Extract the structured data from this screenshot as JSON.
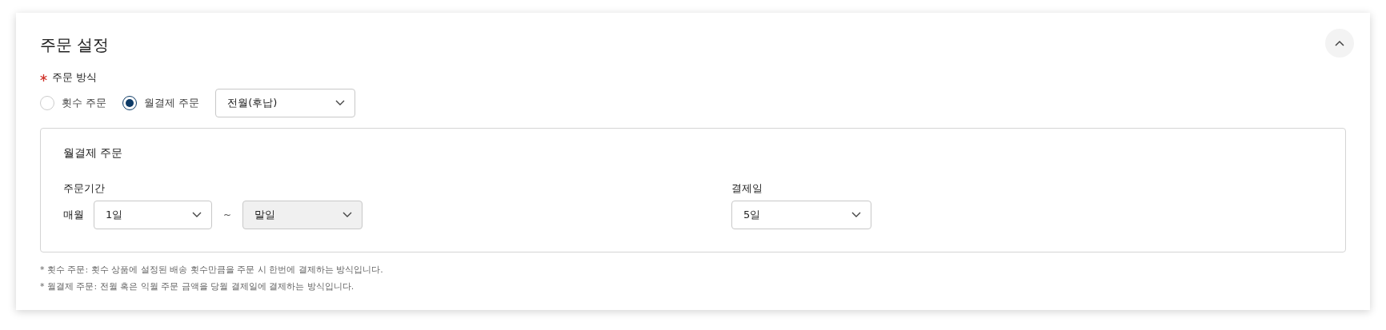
{
  "section": {
    "title": "주문 설정",
    "expanded": true
  },
  "order_method": {
    "label": "주문 방식",
    "required": true,
    "options": [
      {
        "label": "횟수 주문",
        "selected": false
      },
      {
        "label": "월결제 주문",
        "selected": true
      }
    ],
    "select": {
      "value": "전월(후납)",
      "disabled": false
    }
  },
  "monthly": {
    "title": "월결제 주문",
    "period": {
      "label": "주문기간",
      "prefix": "매월",
      "separator": "~",
      "start": {
        "value": "1일",
        "disabled": false
      },
      "end": {
        "value": "말일",
        "disabled": true
      }
    },
    "payment_day": {
      "label": "결제일",
      "select": {
        "value": "5일",
        "disabled": false
      }
    }
  },
  "notes": [
    "* 횟수 주문: 횟수 상품에 설정된 배송 횟수만큼을 주문 시 한번에 결제하는 방식입니다.",
    "* 월결제 주문: 전월 혹은 익월 주문 금액을 당월 결제일에 결제하는 방식입니다."
  ]
}
